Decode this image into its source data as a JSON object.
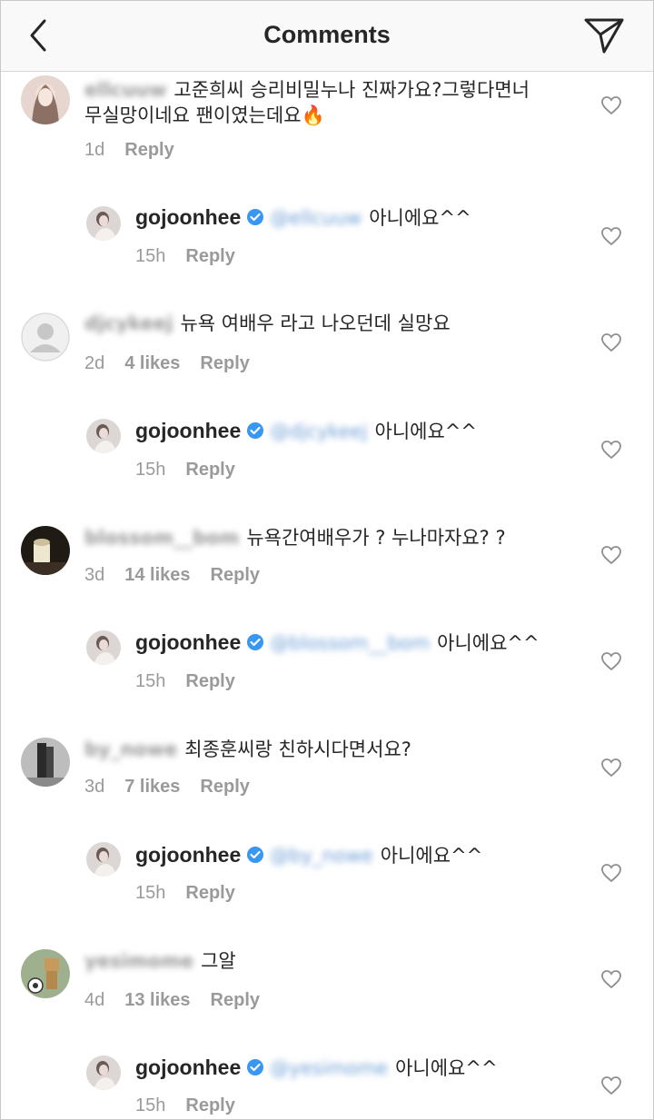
{
  "header": {
    "title": "Comments",
    "back_icon": "chevron-left-icon",
    "send_icon": "paper-plane-icon"
  },
  "colors": {
    "text": "#262626",
    "meta": "#9a9a9a",
    "verified": "#3897f0",
    "header_bg": "#f9f9f9",
    "mention": "#3897f0"
  },
  "thread": [
    {
      "username": "ellcuuw",
      "text_line1": "고준희씨 승리비밀누나 진짜가요?그렇다면너",
      "text_line2": "무실망이네요 팬이였는데요🔥",
      "time": "1d",
      "likes": "",
      "reply_label": "Reply",
      "reply": {
        "username": "gojoonhee",
        "mention": "@ellcuuw",
        "text": "아니에요^^",
        "time": "15h",
        "reply_label": "Reply"
      }
    },
    {
      "username": "djcykeej",
      "text_line1": "뉴욕 여배우 라고 나오던데 실망요",
      "text_line2": "",
      "time": "2d",
      "likes": "4 likes",
      "reply_label": "Reply",
      "reply": {
        "username": "gojoonhee",
        "mention": "@djcykeej",
        "text": "아니에요^^",
        "time": "15h",
        "reply_label": "Reply"
      }
    },
    {
      "username": "blossom__bom",
      "text_line1": "뉴욕간여배우가 ? 누나마자요? ?",
      "text_line2": "",
      "time": "3d",
      "likes": "14 likes",
      "reply_label": "Reply",
      "reply": {
        "username": "gojoonhee",
        "mention": "@blossom__bom",
        "text": "아니에요^^",
        "time": "15h",
        "reply_label": "Reply"
      }
    },
    {
      "username": "by_nowe",
      "text_line1": "최종훈씨랑 친하시다면서요?",
      "text_line2": "",
      "time": "3d",
      "likes": "7 likes",
      "reply_label": "Reply",
      "reply": {
        "username": "gojoonhee",
        "mention": "@by_nowe",
        "text": "아니에요^^",
        "time": "15h",
        "reply_label": "Reply"
      }
    },
    {
      "username": "yesimome",
      "text_line1": "그알",
      "text_line2": "",
      "time": "4d",
      "likes": "13 likes",
      "reply_label": "Reply",
      "reply": {
        "username": "gojoonhee",
        "mention": "@yesimome",
        "text": "아니에요^^",
        "time": "15h",
        "reply_label": "Reply"
      }
    }
  ]
}
